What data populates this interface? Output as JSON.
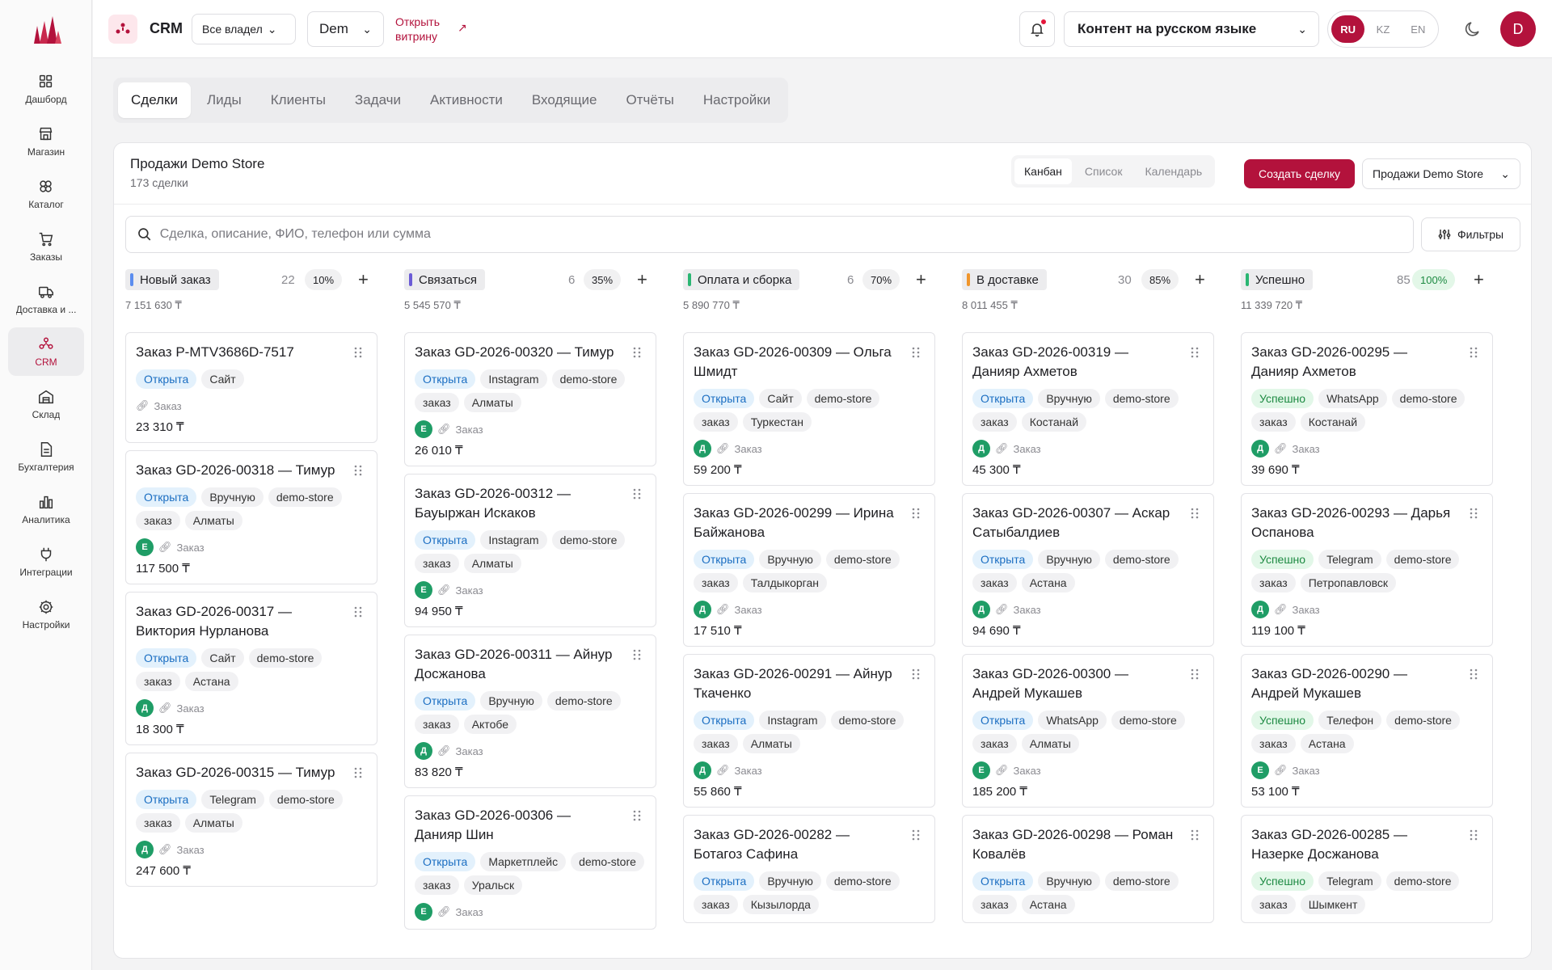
{
  "sidebar": {
    "items": [
      {
        "label": "Дашборд",
        "icon": "dashboard-icon"
      },
      {
        "label": "Магазин",
        "icon": "store-icon"
      },
      {
        "label": "Каталог",
        "icon": "catalog-icon"
      },
      {
        "label": "Заказы",
        "icon": "cart-icon"
      },
      {
        "label": "Доставка и ...",
        "icon": "truck-icon"
      },
      {
        "label": "CRM",
        "icon": "crm-icon"
      },
      {
        "label": "Склад",
        "icon": "warehouse-icon"
      },
      {
        "label": "Бухгалтерия",
        "icon": "document-icon"
      },
      {
        "label": "Аналитика",
        "icon": "chart-icon"
      },
      {
        "label": "Интеграции",
        "icon": "plug-icon"
      },
      {
        "label": "Настройки",
        "icon": "gear-icon"
      }
    ]
  },
  "topbar": {
    "title": "CRM",
    "owners": "Все владел",
    "store": "Dem",
    "open_store": "Открыть витрину",
    "content_lang": "Контент на русском языке",
    "langs": [
      "RU",
      "KZ",
      "EN"
    ],
    "avatar": "D"
  },
  "tabs": [
    "Сделки",
    "Лиды",
    "Клиенты",
    "Задачи",
    "Активности",
    "Входящие",
    "Отчёты",
    "Настройки"
  ],
  "panel": {
    "title": "Продажи Demo Store",
    "subtitle": "173 сделки",
    "views": [
      "Канбан",
      "Список",
      "Календарь"
    ],
    "create": "Создать сделку",
    "pipeline": "Продажи Demo Store",
    "search_placeholder": "Сделка, описание, ФИО, телефон или сумма",
    "filters": "Фильтры"
  },
  "colors": {
    "accent": "#b3123c",
    "open": "#1b6ec2",
    "success": "#1d8a42"
  },
  "columns": [
    {
      "name": "Новый заказ",
      "color": "#5b8def",
      "count": "22",
      "percent": "10%",
      "sum": "7 151 630 ₸",
      "cards": [
        {
          "title": "Заказ P-MTV3686D-7517",
          "status": "Открыта",
          "tags": [
            "Сайт"
          ],
          "avatar": "",
          "link": "Заказ",
          "amount": "23 310 ₸"
        },
        {
          "title": "Заказ GD-2026-00318 — Тимур",
          "status": "Открыта",
          "tags": [
            "Вручную",
            "demo-store",
            "заказ",
            "Алматы"
          ],
          "avatar": "Е",
          "link": "Заказ",
          "amount": "117 500 ₸"
        },
        {
          "title": "Заказ GD-2026-00317 — Виктория Нурланова",
          "status": "Открыта",
          "tags": [
            "Сайт",
            "demo-store",
            "заказ",
            "Астана"
          ],
          "avatar": "Д",
          "link": "Заказ",
          "amount": "18 300 ₸"
        },
        {
          "title": "Заказ GD-2026-00315 — Тимур",
          "status": "Открыта",
          "tags": [
            "Telegram",
            "demo-store",
            "заказ",
            "Алматы"
          ],
          "avatar": "Д",
          "link": "Заказ",
          "amount": "247 600 ₸"
        }
      ]
    },
    {
      "name": "Связаться",
      "color": "#6b5bd6",
      "count": "6",
      "percent": "35%",
      "sum": "5 545 570 ₸",
      "cards": [
        {
          "title": "Заказ GD-2026-00320 — Тимур",
          "status": "Открыта",
          "tags": [
            "Instagram",
            "demo-store",
            "заказ",
            "Алматы"
          ],
          "avatar": "Е",
          "link": "Заказ",
          "amount": "26 010 ₸"
        },
        {
          "title": "Заказ GD-2026-00312 — Бауыржан Искаков",
          "status": "Открыта",
          "tags": [
            "Instagram",
            "demo-store",
            "заказ",
            "Алматы"
          ],
          "avatar": "Е",
          "link": "Заказ",
          "amount": "94 950 ₸"
        },
        {
          "title": "Заказ GD-2026-00311 — Айнур Досжанова",
          "status": "Открыта",
          "tags": [
            "Вручную",
            "demo-store",
            "заказ",
            "Актобе"
          ],
          "avatar": "Д",
          "link": "Заказ",
          "amount": "83 820 ₸"
        },
        {
          "title": "Заказ GD-2026-00306 — Данияр Шин",
          "status": "Открыта",
          "tags": [
            "Маркетплейс",
            "demo-store",
            "заказ",
            "Уральск"
          ],
          "avatar": "Е",
          "link": "Заказ",
          "amount": ""
        }
      ]
    },
    {
      "name": "Оплата и сборка",
      "color": "#2bb673",
      "count": "6",
      "percent": "70%",
      "sum": "5 890 770 ₸",
      "cards": [
        {
          "title": "Заказ GD-2026-00309 — Ольга Шмидт",
          "status": "Открыта",
          "tags": [
            "Сайт",
            "demo-store",
            "заказ",
            "Туркестан"
          ],
          "avatar": "Д",
          "link": "Заказ",
          "amount": "59 200 ₸"
        },
        {
          "title": "Заказ GD-2026-00299 — Ирина Байжанова",
          "status": "Открыта",
          "tags": [
            "Вручную",
            "demo-store",
            "заказ",
            "Талдыкорган"
          ],
          "avatar": "Д",
          "link": "Заказ",
          "amount": "17 510 ₸"
        },
        {
          "title": "Заказ GD-2026-00291 — Айнур Ткаченко",
          "status": "Открыта",
          "tags": [
            "Instagram",
            "demo-store",
            "заказ",
            "Алматы"
          ],
          "avatar": "Д",
          "link": "Заказ",
          "amount": "55 860 ₸"
        },
        {
          "title": "Заказ GD-2026-00282 — Ботагоз Сафина",
          "status": "Открыта",
          "tags": [
            "Вручную",
            "demo-store",
            "заказ",
            "Кызылорда"
          ],
          "avatar": "",
          "link": "",
          "amount": ""
        }
      ]
    },
    {
      "name": "В доставке",
      "color": "#f0952b",
      "count": "30",
      "percent": "85%",
      "sum": "8 011 455 ₸",
      "cards": [
        {
          "title": "Заказ GD-2026-00319 — Данияр Ахметов",
          "status": "Открыта",
          "tags": [
            "Вручную",
            "demo-store",
            "заказ",
            "Костанай"
          ],
          "avatar": "Д",
          "link": "Заказ",
          "amount": "45 300 ₸"
        },
        {
          "title": "Заказ GD-2026-00307 — Аскар Сатыбалдиев",
          "status": "Открыта",
          "tags": [
            "Вручную",
            "demo-store",
            "заказ",
            "Астана"
          ],
          "avatar": "Д",
          "link": "Заказ",
          "amount": "94 690 ₸"
        },
        {
          "title": "Заказ GD-2026-00300 — Андрей Мукашев",
          "status": "Открыта",
          "tags": [
            "WhatsApp",
            "demo-store",
            "заказ",
            "Алматы"
          ],
          "avatar": "Е",
          "link": "Заказ",
          "amount": "185 200 ₸"
        },
        {
          "title": "Заказ GD-2026-00298 — Роман Ковалёв",
          "status": "Открыта",
          "tags": [
            "Вручную",
            "demo-store",
            "заказ",
            "Астана"
          ],
          "avatar": "",
          "link": "",
          "amount": ""
        }
      ]
    },
    {
      "name": "Успешно",
      "color": "#2bb673",
      "count": "85",
      "percent": "100%",
      "sum": "11 339 720 ₸",
      "cards": [
        {
          "title": "Заказ GD-2026-00295 — Данияр Ахметов",
          "status": "Успешно",
          "tags": [
            "WhatsApp",
            "demo-store",
            "заказ",
            "Костанай"
          ],
          "avatar": "Д",
          "link": "Заказ",
          "amount": "39 690 ₸"
        },
        {
          "title": "Заказ GD-2026-00293 — Дарья Оспанова",
          "status": "Успешно",
          "tags": [
            "Telegram",
            "demo-store",
            "заказ",
            "Петропавловск"
          ],
          "avatar": "Д",
          "link": "Заказ",
          "amount": "119 100 ₸"
        },
        {
          "title": "Заказ GD-2026-00290 — Андрей Мукашев",
          "status": "Успешно",
          "tags": [
            "Телефон",
            "demo-store",
            "заказ",
            "Астана"
          ],
          "avatar": "Е",
          "link": "Заказ",
          "amount": "53 100 ₸"
        },
        {
          "title": "Заказ GD-2026-00285 — Назерке Досжанова",
          "status": "Успешно",
          "tags": [
            "Telegram",
            "demo-store",
            "заказ",
            "Шымкент"
          ],
          "avatar": "",
          "link": "",
          "amount": ""
        }
      ]
    }
  ]
}
